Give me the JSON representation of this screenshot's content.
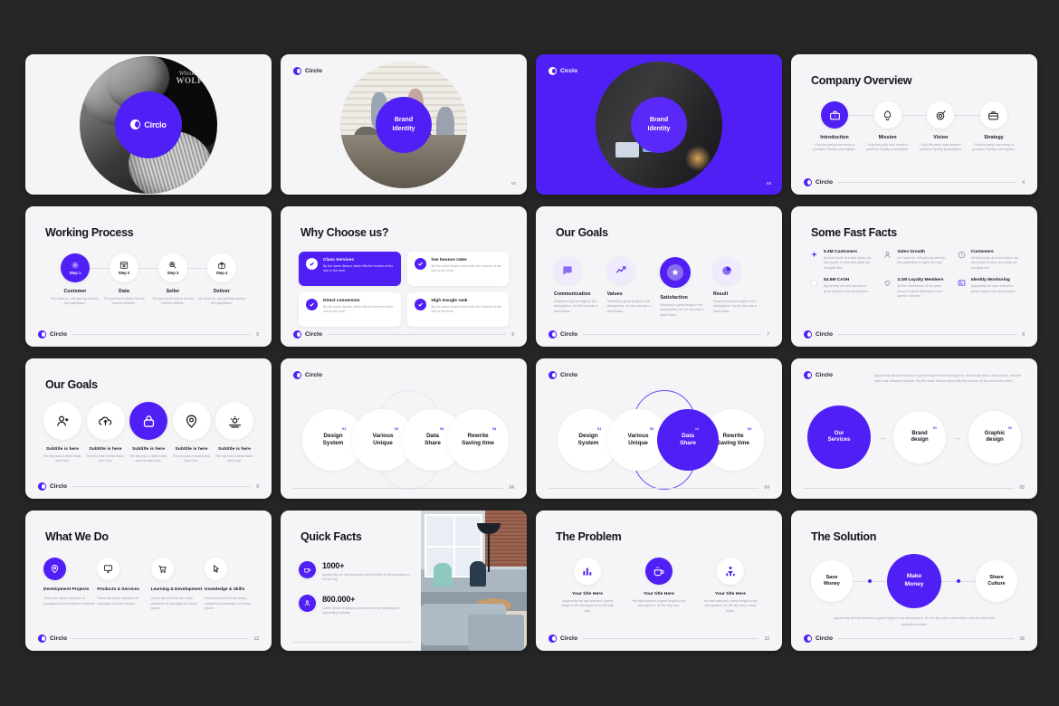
{
  "brand": {
    "name": "Circlo",
    "accent": "#4f1ff5"
  },
  "lorem": {
    "a": "Only the party host needs a premium Spotify subscription.",
    "b": "As I went on, still gaining velocity, the palpitation.",
    "c": "The spectacle before us was indeed sublime.",
    "d": "By the same illusion which lifts the horizon of the sea to the level.",
    "e": "Reached a great height in the atmosphere, for the sky was a dead black.",
    "f": "The sky was a dead black, and hardly more than.",
    "g": "There are many variations of passages of Lorem Ipsum available.",
    "h": "Lorem Ipsum there are many variations of passages of Lorem Ipsum.",
    "i": "Apparently we had reached a great height in the atmosphere, for the sky was a dead black, and the stars had ceased to twinkle. By the same illusion which lifts the horizon of the sea to the level.",
    "j": "Apparently we had reached a great height in the atmosphere, for the sky was a dead black, and the stars had ceased to twinkle."
  },
  "slides": [
    {
      "n": 1,
      "kind": "cover",
      "badge": "Circlo",
      "photo_text_top": "Whiskey",
      "photo_text_bottom": "WOLF"
    },
    {
      "n": 2,
      "kind": "brand-identity-light",
      "badge_l1": "Brand",
      "badge_l2": "Identity",
      "page": "02"
    },
    {
      "n": 3,
      "kind": "brand-identity-purple",
      "badge_l1": "Brand",
      "badge_l2": "Identity",
      "page": "03"
    },
    {
      "n": 4,
      "kind": "company-overview",
      "title": "Company Overview",
      "page": "4",
      "items": [
        {
          "label": "Introduction",
          "icon": "briefcase-icon",
          "active": true,
          "text": "Only the party host needs a premium Spotify subscription."
        },
        {
          "label": "Mission",
          "icon": "rocket-icon",
          "active": false,
          "text": "Only the party host needs a premium Spotify subscription."
        },
        {
          "label": "Vision",
          "icon": "target-icon",
          "active": false,
          "text": "Only the party host needs a premium Spotify subscription."
        },
        {
          "label": "Strategy",
          "icon": "toolbox-icon",
          "active": false,
          "text": "Only the party host needs a premium Spotify subscription."
        }
      ]
    },
    {
      "n": 5,
      "kind": "working-process",
      "title": "Working Process",
      "page": "5",
      "items": [
        {
          "step": "Step 1",
          "label": "Customer",
          "icon": "network-icon",
          "active": true,
          "text": "As I went on, still gaining velocity, the palpitation."
        },
        {
          "step": "Step 2",
          "label": "Data",
          "icon": "browser-icon",
          "active": false,
          "text": "The spectacle before us was indeed sublime."
        },
        {
          "step": "Step 3",
          "label": "Seller",
          "icon": "search-user-icon",
          "active": false,
          "text": "The spectacle before us was indeed sublime."
        },
        {
          "step": "Step 4",
          "label": "Deliver",
          "icon": "gift-icon",
          "active": false,
          "text": "As I went on, still gaining velocity, the palpitation."
        }
      ]
    },
    {
      "n": 6,
      "kind": "why-choose",
      "title": "Why Choose us?",
      "page": "6",
      "cards": [
        {
          "label": "Class Services",
          "active": true,
          "text": "By the same illusion which lifts the horizon of the sea to the level."
        },
        {
          "label": "low bounce rates",
          "active": false,
          "text": "By the same illusion which lifts the horizon of the sea to the level."
        },
        {
          "label": "Direct conversion",
          "active": false,
          "text": "By the same illusion which lifts the horizon of the sea to the level."
        },
        {
          "label": "High Google rank",
          "active": false,
          "text": "By the same illusion which lifts the horizon of the sea to the level."
        }
      ]
    },
    {
      "n": 7,
      "kind": "our-goals-4",
      "title": "Our Goals",
      "page": "7",
      "items": [
        {
          "label": "Communication",
          "icon": "chat-search-icon",
          "active": false,
          "text": "Reached a great height in the atmosphere, for the sky was a dead black."
        },
        {
          "label": "Values",
          "icon": "chart-arrow-icon",
          "active": false,
          "text": "Reached a great height in the atmosphere, for the sky was a dead black."
        },
        {
          "label": "Satisfaction",
          "icon": "star-badge-icon",
          "active": true,
          "text": "Reached a great height in the atmosphere, for the sky was a dead black."
        },
        {
          "label": "Result",
          "icon": "pie-chart-icon",
          "active": false,
          "text": "Reached a great height in the atmosphere, for the sky was a dead black."
        }
      ]
    },
    {
      "n": 8,
      "kind": "fast-facts",
      "title": "Some Fast Facts",
      "page": "8",
      "items": [
        {
          "label": "5.2M Customers",
          "icon": "spark-icon",
          "text": "All that it puts at a time dawn, we had power to view and party our thoughts like."
        },
        {
          "label": "Sales Growth",
          "icon": "user-icon",
          "text": "As I went on, still gaining velocity, the palpitation of night and day."
        },
        {
          "label": "Customers",
          "icon": "clock-icon",
          "text": "All that it puts at a time dawn, we had power to view and party our thoughts like."
        },
        {
          "label": "$4.5M CASH",
          "icon": "coin-icon",
          "text": "Apparently we had reached a great height in the atmosphere."
        },
        {
          "label": "3.1M Loyalty Members",
          "icon": "heart-icon",
          "text": "As the minuteness of the parts formed a great hindrance to the speed I seemed."
        },
        {
          "label": "Identity Monitoring",
          "icon": "id-card-icon",
          "text": "Apparently we had reached a great height in the atmosphere."
        }
      ]
    },
    {
      "n": 9,
      "kind": "our-goals-5",
      "title": "Our Goals",
      "page": "9",
      "items": [
        {
          "label": "Subtitle is here",
          "icon": "add-user-icon",
          "active": false,
          "text": "The sky was a dead black, even had."
        },
        {
          "label": "Subtitle is here",
          "icon": "cloud-upload-icon",
          "active": false,
          "text": "The sky was a dead black, even had."
        },
        {
          "label": "Subtitle is here",
          "icon": "lock-icon",
          "active": true,
          "text": "The sky was a dead black, and the stars had."
        },
        {
          "label": "Subtitle is here",
          "icon": "location-pin-icon",
          "active": false,
          "text": "The sky was a dead black, stars had."
        },
        {
          "label": "Subtitle is here",
          "icon": "sunrise-icon",
          "active": false,
          "text": "The sky was a dead black, stars had."
        }
      ]
    },
    {
      "n": 10,
      "kind": "venn",
      "page": "04",
      "highlight": -1,
      "items": [
        {
          "l1": "Design",
          "l2": "System",
          "num": "01"
        },
        {
          "l1": "Various",
          "l2": "Unique",
          "num": "02"
        },
        {
          "l1": "Data",
          "l2": "Share",
          "num": "03"
        },
        {
          "l1": "Rewrite",
          "l2": "Saving time",
          "num": "04"
        }
      ]
    },
    {
      "n": 11,
      "kind": "venn",
      "page": "04",
      "highlight": 2,
      "items": [
        {
          "l1": "Design",
          "l2": "System",
          "num": "01"
        },
        {
          "l1": "Various",
          "l2": "Unique",
          "num": "02"
        },
        {
          "l1": "Data",
          "l2": "Share",
          "num": "03"
        },
        {
          "l1": "Rewrite",
          "l2": "Saving time",
          "num": "04"
        }
      ]
    },
    {
      "n": 12,
      "kind": "services-flow",
      "page": "02",
      "intro": "Apparently we had reached a great height in the atmosphere, for the sky was a dead black, and the stars had ceased to twinkle. By the same illusion which lifts the horizon of the sea to the level.",
      "nodes": [
        {
          "l1": "Our",
          "l2": "Services",
          "num": "",
          "active": true
        },
        {
          "l1": "Brand",
          "l2": "design",
          "num": "01",
          "active": false
        },
        {
          "l1": "Graphic",
          "l2": "design",
          "num": "02",
          "active": false
        }
      ]
    },
    {
      "n": 13,
      "kind": "what-we-do",
      "title": "What We Do",
      "page": "12",
      "items": [
        {
          "label": "Development Projects",
          "icon": "location-pin-icon",
          "active": true,
          "text": "There are many variations of passages of Lorem Ipsum available."
        },
        {
          "label": "Products & Services",
          "icon": "monitor-icon",
          "active": false,
          "text": "There are many variations of passages of Lorem Ipsum."
        },
        {
          "label": "Learning & Development",
          "icon": "cart-icon",
          "active": false,
          "text": "Lorem Ipsum there are many variations of passages of Lorem Ipsum."
        },
        {
          "label": "Knowledge & Skills",
          "icon": "click-icon",
          "active": false,
          "text": "Lorem Ipsum there are many variations of passages of Lorem Ipsum."
        }
      ]
    },
    {
      "n": 14,
      "kind": "quick-facts",
      "title": "Quick Facts",
      "items": [
        {
          "value": "1000+",
          "icon": "coffee-icon",
          "text": "Apparently we had reached a great height in the atmosphere, for the sky."
        },
        {
          "value": "800.000+",
          "icon": "people-icon",
          "text": "Lorem Ipsum is simply dummy text of the printing and typesetting industry."
        }
      ]
    },
    {
      "n": 15,
      "kind": "problem",
      "title": "The Problem",
      "page": "15",
      "items": [
        {
          "label": "Your title Here",
          "icon": "bar-chart-icon",
          "active": false,
          "text": "Apparently we had reached a great height in the atmosphere for the sky was."
        },
        {
          "label": "Your title Here",
          "icon": "coffee-icon",
          "active": true,
          "text": "We had reached a great height in the atmosphere, for the sky was."
        },
        {
          "label": "Your title Here",
          "icon": "people-chart-icon",
          "active": false,
          "text": "We had reached a great height in the atmosphere, for the sky was a dead black."
        }
      ]
    },
    {
      "n": 16,
      "kind": "solution",
      "title": "The Solution",
      "page": "16",
      "nodes": [
        {
          "l1": "Save",
          "l2": "Money",
          "active": false
        },
        {
          "l1": "Make",
          "l2": "Money",
          "active": true
        },
        {
          "l1": "Share",
          "l2": "Culture",
          "active": false
        }
      ],
      "caption": "Apparently we had reached a great height in the atmosphere, for the sky was a dead black, and the stars had ceased to twinkle."
    }
  ]
}
